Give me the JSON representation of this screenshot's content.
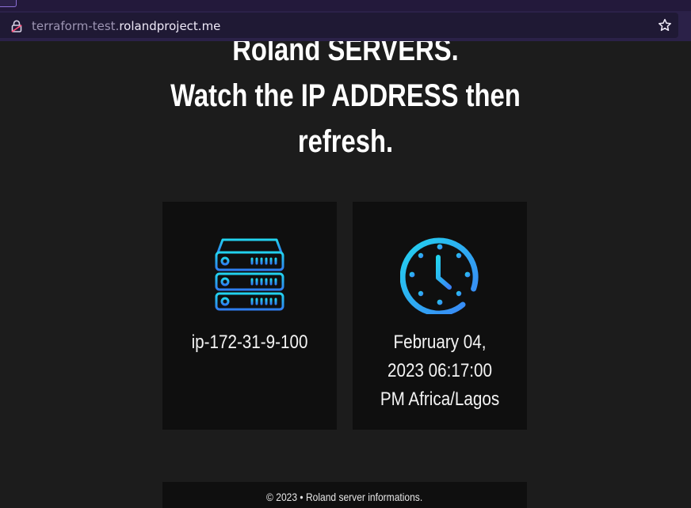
{
  "browser": {
    "url_subdomain": "terraform-test.",
    "url_domain": "rolandproject.me"
  },
  "page": {
    "headline_lines": [
      "Roland SERVERS.",
      "Watch the IP ADDRESS then",
      "refresh."
    ]
  },
  "cards": {
    "server": {
      "icon": "server-icon",
      "hostname": "ip-172-31-9-100"
    },
    "clock": {
      "icon": "clock-icon",
      "datetime_lines": [
        "February 04,",
        "2023 06:17:00",
        "PM Africa/Lagos"
      ]
    }
  },
  "footer": {
    "text": "© 2023 • Roland server informations."
  },
  "colors": {
    "browser_chrome": "#2b2148",
    "url_bar": "#1f1934",
    "page_background": "#1c1c1c",
    "card_background": "#0f0f0f",
    "icon_gradient_start": "#22d3ee",
    "icon_gradient_end": "#3b82f6"
  }
}
